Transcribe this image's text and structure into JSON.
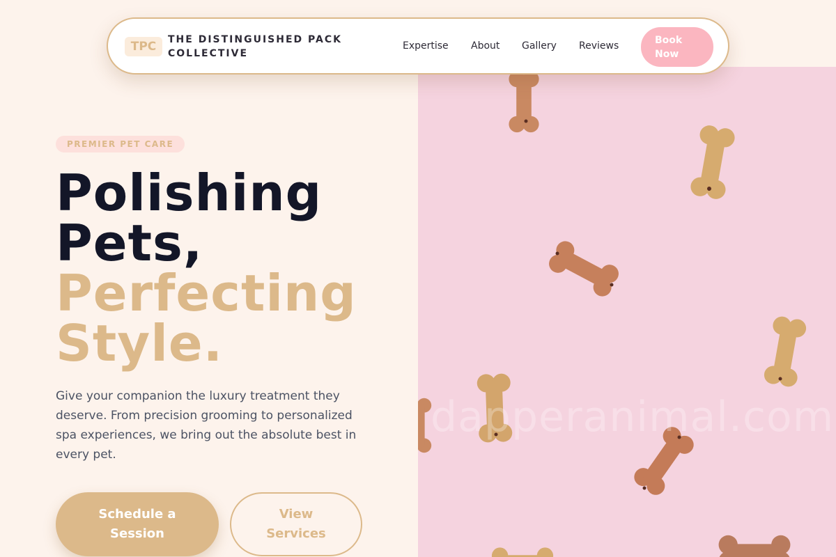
{
  "header": {
    "logo_text": "TPC",
    "brand_name": "THE DISTINGUISHED PACK COLLECTIVE",
    "nav": [
      "Expertise",
      "About",
      "Gallery",
      "Reviews"
    ],
    "cta_label": "Book Now"
  },
  "hero": {
    "tag": "PREMIER PET CARE",
    "headline_line1": "Polishing",
    "headline_line2": "Pets,",
    "headline_line3": "Perfecting",
    "headline_line4": "Style.",
    "lead": "Give your companion the luxury treatment they deserve. From precision grooming to personalized spa experiences, we bring out the absolute best in every pet.",
    "primary_cta": "Schedule a Session",
    "secondary_cta": "View Services"
  },
  "image": {
    "watermark": "dapperanimal.com",
    "subject": "dog-bone-biscuits-icon"
  },
  "colors": {
    "page_background": "#fdf3ec",
    "accent_gold": "#dcb98a",
    "accent_pink": "#fbb6c0",
    "heading_dark": "#131628",
    "image_background": "#f5d3df"
  }
}
